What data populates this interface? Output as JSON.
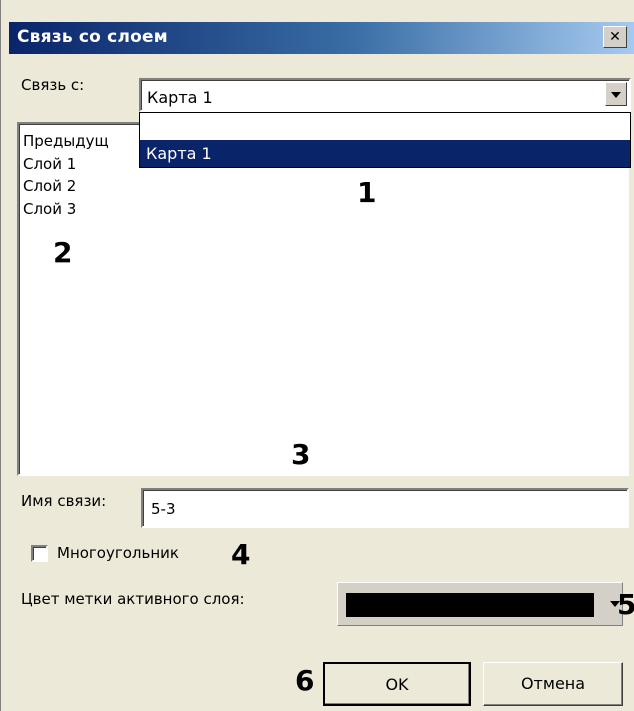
{
  "window": {
    "title": "Связь со слоем",
    "close_glyph": "✕"
  },
  "link": {
    "label": "Связь с:",
    "selected": "Карта 1",
    "dropdown_options": [
      "",
      "Карта 1"
    ]
  },
  "layers": {
    "items": [
      "Предыдущ",
      "Слой 1",
      "Слой 2",
      "Слой 3"
    ]
  },
  "link_name": {
    "label": "Имя связи:",
    "value": "5-3"
  },
  "polygon": {
    "label": "Многоугольник",
    "checked": false
  },
  "active_color": {
    "label": "Цвет метки активного слоя:",
    "color": "#000000"
  },
  "buttons": {
    "ok": "OK",
    "cancel": "Отмена"
  },
  "callouts": [
    "1",
    "2",
    "3",
    "4",
    "5",
    "6"
  ],
  "colors": {
    "title_start": "#0a246a",
    "title_end": "#a6caf0",
    "selection": "#0a246a",
    "dialog_bg": "#ece9d8"
  }
}
